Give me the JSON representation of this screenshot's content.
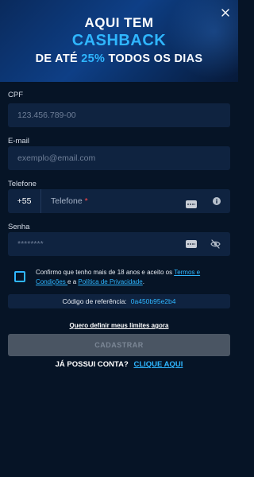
{
  "banner": {
    "line1": "AQUI TEM",
    "line2": "CASHBACK",
    "line3_pre": "DE ATÉ ",
    "line3_highlight": "25%",
    "line3_post": " TODOS OS DIAS"
  },
  "icons": {
    "close": "close-icon",
    "keyboard": "keyboard-icon",
    "info": "info-icon",
    "eye_off": "eye-off-icon"
  },
  "form": {
    "cpf": {
      "label": "CPF",
      "placeholder": "123.456.789-00"
    },
    "email": {
      "label": "E-mail",
      "placeholder": "exemplo@email.com"
    },
    "phone": {
      "label": "Telefone",
      "prefix": "+55",
      "placeholder": "Telefone",
      "required_mark": "*"
    },
    "password": {
      "label": "Senha",
      "placeholder": "********"
    }
  },
  "consent": {
    "text_pre": "Confirmo que tenho mais de 18 anos e aceito os ",
    "terms_link": "Termos e Condições ",
    "text_mid": "e a ",
    "privacy_link": "Política de Privacidade",
    "text_post": "."
  },
  "referral": {
    "label": "Código de referência:",
    "code": "0a450b95e2b4"
  },
  "limits_link": "Quero definir meus limites agora",
  "submit_label": "CADASTRAR",
  "login": {
    "question": "JÁ POSSUI CONTA?",
    "link": "CLIQUE AQUI"
  },
  "colors": {
    "background": "#061426",
    "field": "#0f2340",
    "accent": "#2fb6ff",
    "button_disabled": "#4a5563"
  }
}
